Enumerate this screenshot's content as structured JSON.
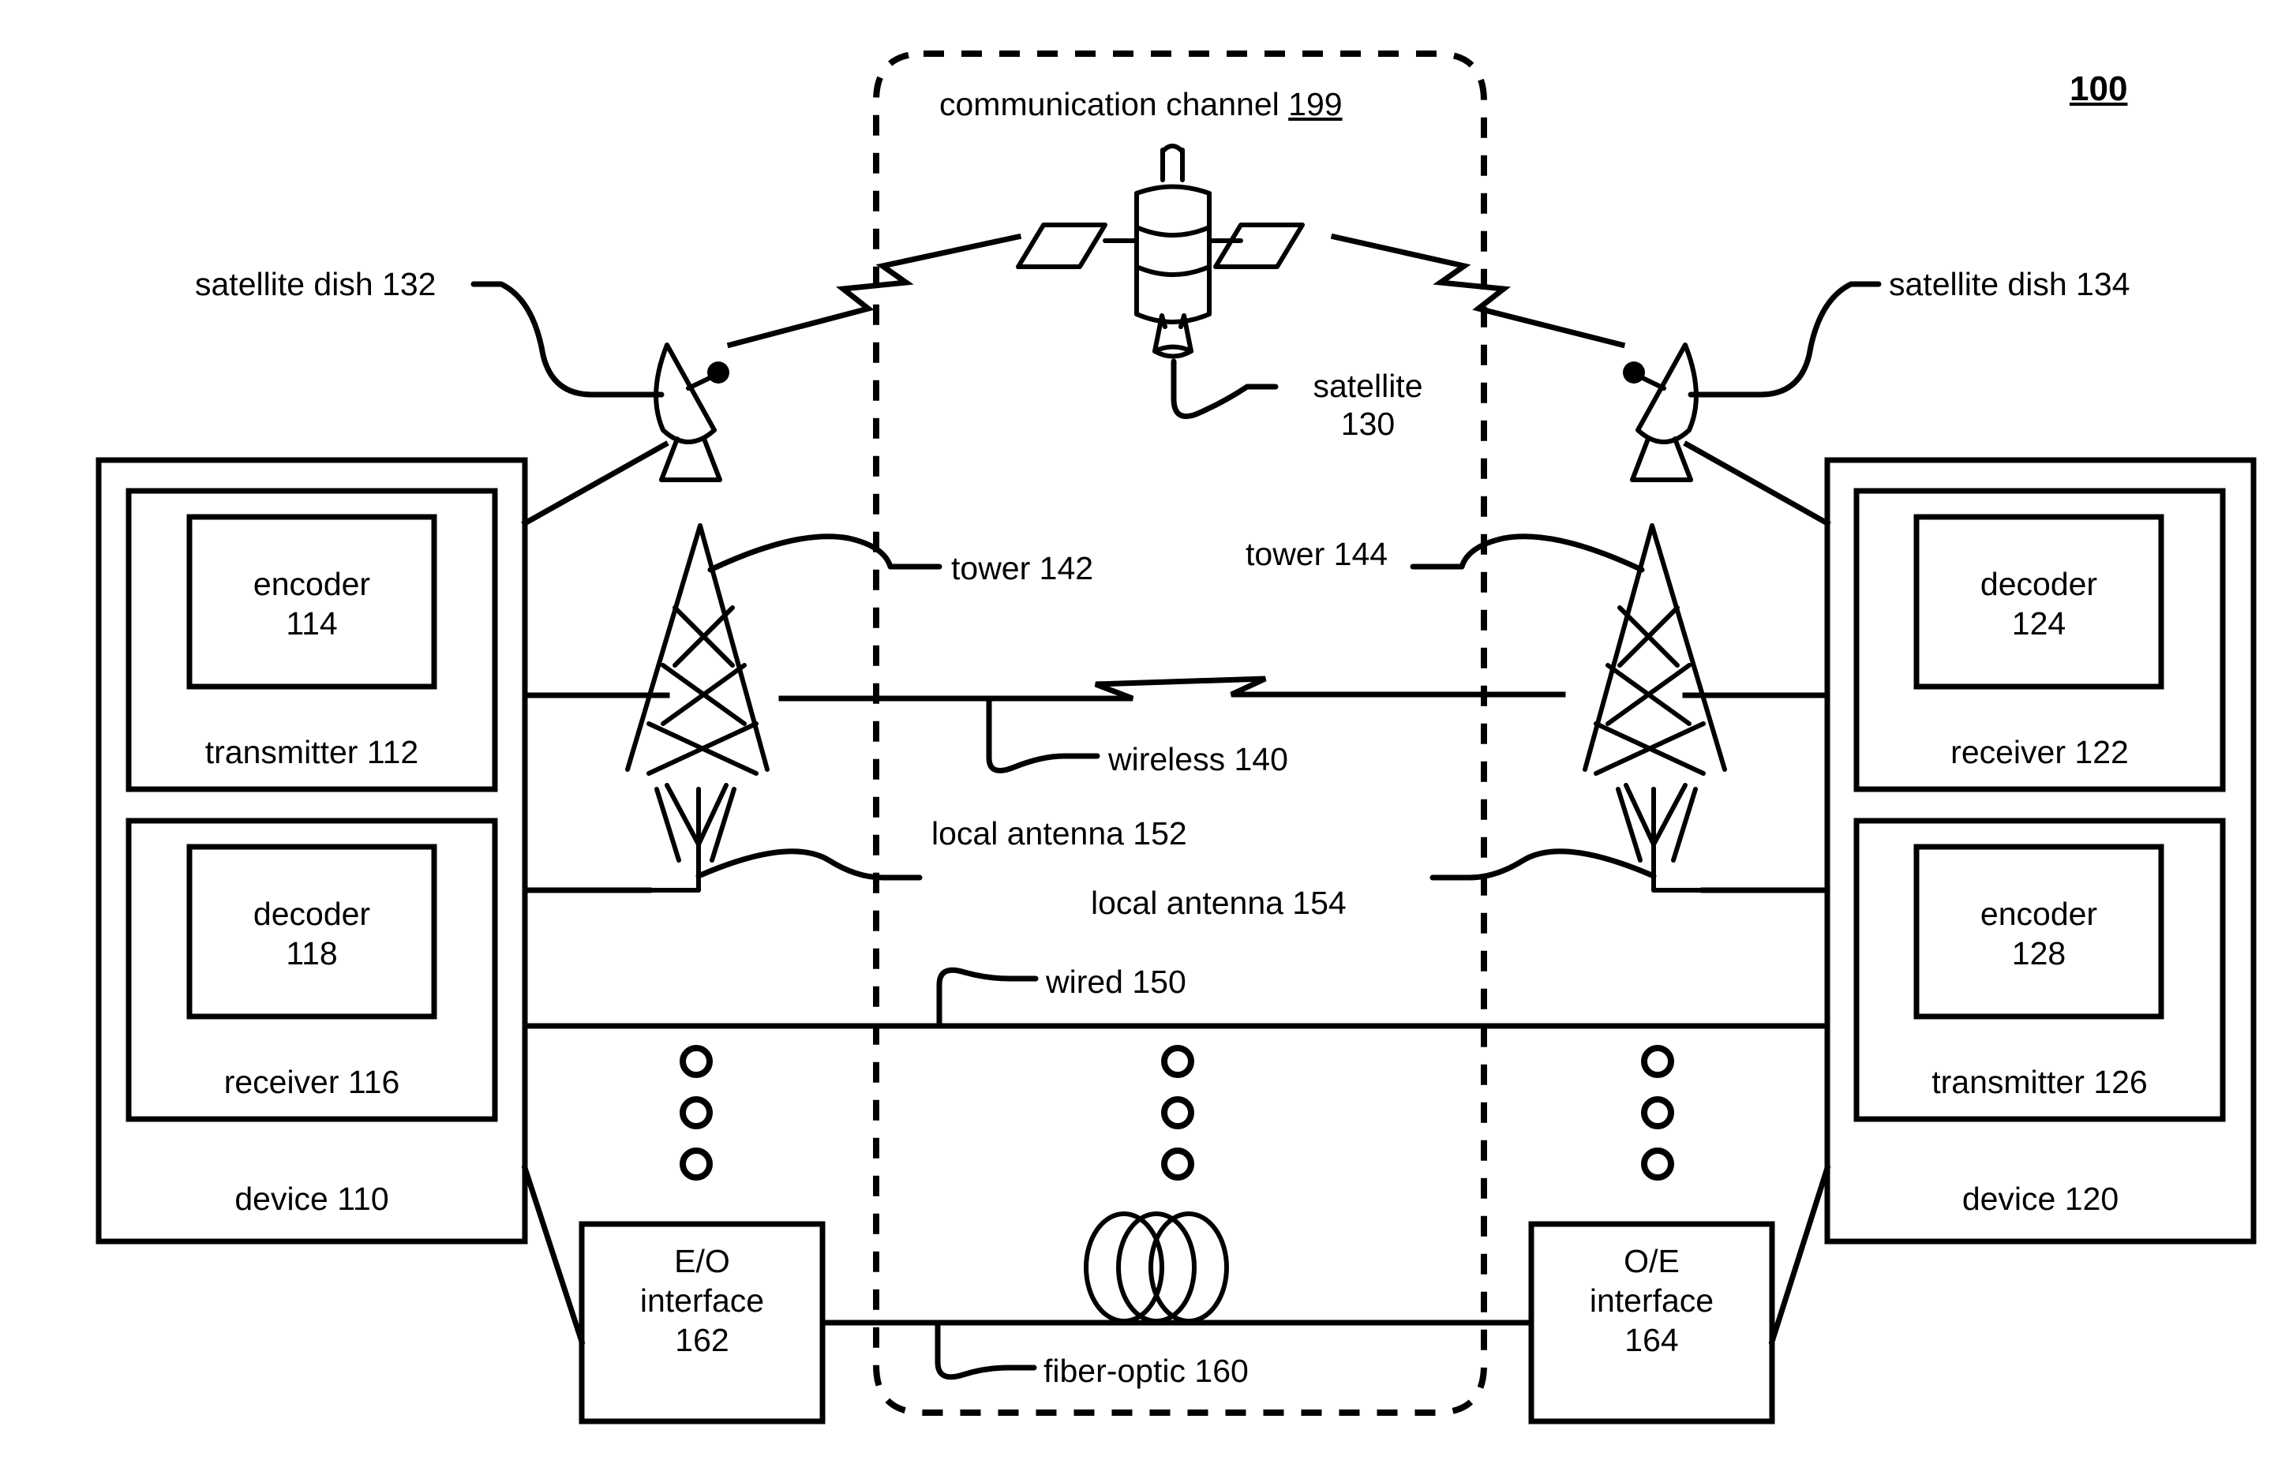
{
  "figure": {
    "number": "100",
    "type": "patent-block-diagram"
  },
  "channel": {
    "label_text": "communication channel",
    "label_ref": "199"
  },
  "left_device": {
    "label_text": "device",
    "label_ref": "110",
    "transmitter": {
      "label_text": "transmitter",
      "label_ref": "112",
      "inner": {
        "label_text": "encoder",
        "label_ref": "114"
      }
    },
    "receiver": {
      "label_text": "receiver",
      "label_ref": "116",
      "inner": {
        "label_text": "decoder",
        "label_ref": "118"
      }
    }
  },
  "right_device": {
    "label_text": "device",
    "label_ref": "120",
    "receiver": {
      "label_text": "receiver",
      "label_ref": "122",
      "inner": {
        "label_text": "decoder",
        "label_ref": "124"
      }
    },
    "transmitter": {
      "label_text": "transmitter",
      "label_ref": "126",
      "inner": {
        "label_text": "encoder",
        "label_ref": "128"
      }
    }
  },
  "satellite_path": {
    "satellite_label_line1": "satellite",
    "satellite_label_line2": "130",
    "dish_left": "satellite dish 132",
    "dish_right": "satellite dish 134"
  },
  "wireless_path": {
    "tower_left": "tower 142",
    "tower_right": "tower 144",
    "link_label": "wireless 140"
  },
  "local_path": {
    "antenna_left": "local antenna 152",
    "antenna_right": "local antenna 154",
    "link_label": "wired 150"
  },
  "fiber_path": {
    "link_label": "fiber-optic 160",
    "eo_interface": {
      "line1": "E/O",
      "line2": "interface",
      "ref": "162"
    },
    "oe_interface": {
      "line1": "O/E",
      "line2": "interface",
      "ref": "164"
    }
  },
  "colors": {
    "ink": "#000000",
    "paper": "#ffffff"
  }
}
